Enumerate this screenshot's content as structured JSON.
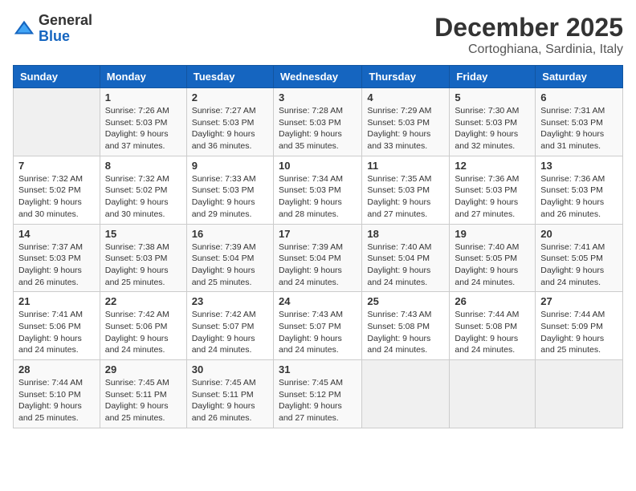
{
  "logo": {
    "general": "General",
    "blue": "Blue"
  },
  "header": {
    "month": "December 2025",
    "location": "Cortoghiana, Sardinia, Italy"
  },
  "weekdays": [
    "Sunday",
    "Monday",
    "Tuesday",
    "Wednesday",
    "Thursday",
    "Friday",
    "Saturday"
  ],
  "weeks": [
    [
      {
        "day": "",
        "sunrise": "",
        "sunset": "",
        "daylight": ""
      },
      {
        "day": "1",
        "sunrise": "Sunrise: 7:26 AM",
        "sunset": "Sunset: 5:03 PM",
        "daylight": "Daylight: 9 hours and 37 minutes."
      },
      {
        "day": "2",
        "sunrise": "Sunrise: 7:27 AM",
        "sunset": "Sunset: 5:03 PM",
        "daylight": "Daylight: 9 hours and 36 minutes."
      },
      {
        "day": "3",
        "sunrise": "Sunrise: 7:28 AM",
        "sunset": "Sunset: 5:03 PM",
        "daylight": "Daylight: 9 hours and 35 minutes."
      },
      {
        "day": "4",
        "sunrise": "Sunrise: 7:29 AM",
        "sunset": "Sunset: 5:03 PM",
        "daylight": "Daylight: 9 hours and 33 minutes."
      },
      {
        "day": "5",
        "sunrise": "Sunrise: 7:30 AM",
        "sunset": "Sunset: 5:03 PM",
        "daylight": "Daylight: 9 hours and 32 minutes."
      },
      {
        "day": "6",
        "sunrise": "Sunrise: 7:31 AM",
        "sunset": "Sunset: 5:03 PM",
        "daylight": "Daylight: 9 hours and 31 minutes."
      }
    ],
    [
      {
        "day": "7",
        "sunrise": "Sunrise: 7:32 AM",
        "sunset": "Sunset: 5:02 PM",
        "daylight": "Daylight: 9 hours and 30 minutes."
      },
      {
        "day": "8",
        "sunrise": "Sunrise: 7:32 AM",
        "sunset": "Sunset: 5:02 PM",
        "daylight": "Daylight: 9 hours and 30 minutes."
      },
      {
        "day": "9",
        "sunrise": "Sunrise: 7:33 AM",
        "sunset": "Sunset: 5:03 PM",
        "daylight": "Daylight: 9 hours and 29 minutes."
      },
      {
        "day": "10",
        "sunrise": "Sunrise: 7:34 AM",
        "sunset": "Sunset: 5:03 PM",
        "daylight": "Daylight: 9 hours and 28 minutes."
      },
      {
        "day": "11",
        "sunrise": "Sunrise: 7:35 AM",
        "sunset": "Sunset: 5:03 PM",
        "daylight": "Daylight: 9 hours and 27 minutes."
      },
      {
        "day": "12",
        "sunrise": "Sunrise: 7:36 AM",
        "sunset": "Sunset: 5:03 PM",
        "daylight": "Daylight: 9 hours and 27 minutes."
      },
      {
        "day": "13",
        "sunrise": "Sunrise: 7:36 AM",
        "sunset": "Sunset: 5:03 PM",
        "daylight": "Daylight: 9 hours and 26 minutes."
      }
    ],
    [
      {
        "day": "14",
        "sunrise": "Sunrise: 7:37 AM",
        "sunset": "Sunset: 5:03 PM",
        "daylight": "Daylight: 9 hours and 26 minutes."
      },
      {
        "day": "15",
        "sunrise": "Sunrise: 7:38 AM",
        "sunset": "Sunset: 5:03 PM",
        "daylight": "Daylight: 9 hours and 25 minutes."
      },
      {
        "day": "16",
        "sunrise": "Sunrise: 7:39 AM",
        "sunset": "Sunset: 5:04 PM",
        "daylight": "Daylight: 9 hours and 25 minutes."
      },
      {
        "day": "17",
        "sunrise": "Sunrise: 7:39 AM",
        "sunset": "Sunset: 5:04 PM",
        "daylight": "Daylight: 9 hours and 24 minutes."
      },
      {
        "day": "18",
        "sunrise": "Sunrise: 7:40 AM",
        "sunset": "Sunset: 5:04 PM",
        "daylight": "Daylight: 9 hours and 24 minutes."
      },
      {
        "day": "19",
        "sunrise": "Sunrise: 7:40 AM",
        "sunset": "Sunset: 5:05 PM",
        "daylight": "Daylight: 9 hours and 24 minutes."
      },
      {
        "day": "20",
        "sunrise": "Sunrise: 7:41 AM",
        "sunset": "Sunset: 5:05 PM",
        "daylight": "Daylight: 9 hours and 24 minutes."
      }
    ],
    [
      {
        "day": "21",
        "sunrise": "Sunrise: 7:41 AM",
        "sunset": "Sunset: 5:06 PM",
        "daylight": "Daylight: 9 hours and 24 minutes."
      },
      {
        "day": "22",
        "sunrise": "Sunrise: 7:42 AM",
        "sunset": "Sunset: 5:06 PM",
        "daylight": "Daylight: 9 hours and 24 minutes."
      },
      {
        "day": "23",
        "sunrise": "Sunrise: 7:42 AM",
        "sunset": "Sunset: 5:07 PM",
        "daylight": "Daylight: 9 hours and 24 minutes."
      },
      {
        "day": "24",
        "sunrise": "Sunrise: 7:43 AM",
        "sunset": "Sunset: 5:07 PM",
        "daylight": "Daylight: 9 hours and 24 minutes."
      },
      {
        "day": "25",
        "sunrise": "Sunrise: 7:43 AM",
        "sunset": "Sunset: 5:08 PM",
        "daylight": "Daylight: 9 hours and 24 minutes."
      },
      {
        "day": "26",
        "sunrise": "Sunrise: 7:44 AM",
        "sunset": "Sunset: 5:08 PM",
        "daylight": "Daylight: 9 hours and 24 minutes."
      },
      {
        "day": "27",
        "sunrise": "Sunrise: 7:44 AM",
        "sunset": "Sunset: 5:09 PM",
        "daylight": "Daylight: 9 hours and 25 minutes."
      }
    ],
    [
      {
        "day": "28",
        "sunrise": "Sunrise: 7:44 AM",
        "sunset": "Sunset: 5:10 PM",
        "daylight": "Daylight: 9 hours and 25 minutes."
      },
      {
        "day": "29",
        "sunrise": "Sunrise: 7:45 AM",
        "sunset": "Sunset: 5:11 PM",
        "daylight": "Daylight: 9 hours and 25 minutes."
      },
      {
        "day": "30",
        "sunrise": "Sunrise: 7:45 AM",
        "sunset": "Sunset: 5:11 PM",
        "daylight": "Daylight: 9 hours and 26 minutes."
      },
      {
        "day": "31",
        "sunrise": "Sunrise: 7:45 AM",
        "sunset": "Sunset: 5:12 PM",
        "daylight": "Daylight: 9 hours and 27 minutes."
      },
      {
        "day": "",
        "sunrise": "",
        "sunset": "",
        "daylight": ""
      },
      {
        "day": "",
        "sunrise": "",
        "sunset": "",
        "daylight": ""
      },
      {
        "day": "",
        "sunrise": "",
        "sunset": "",
        "daylight": ""
      }
    ]
  ]
}
